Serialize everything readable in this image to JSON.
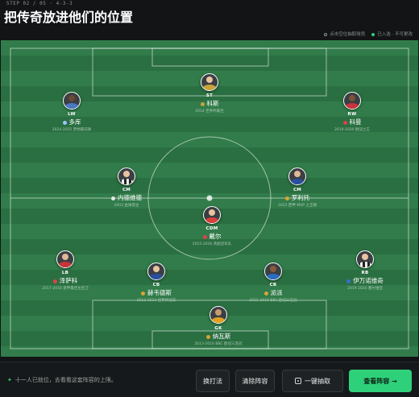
{
  "header": {
    "step": "STEP 02 / 05 · 4-3-3",
    "title": "把传奇放进他们的位置",
    "legend_pick": "点击空位抽取球员",
    "legend_done": "已入选 · 不可更改"
  },
  "colors": {
    "accent": "#2fd07a",
    "pitch_light": "#317c4a",
    "pitch_dark": "#2a6f41"
  },
  "players": [
    {
      "id": "st",
      "position": "ST",
      "name": "科斯",
      "season": "2014 世界杯最佳",
      "kit": "#c9a33a",
      "skin": "#e9c3a1"
    },
    {
      "id": "lw",
      "position": "LW",
      "name": "多库",
      "season": "2024-2025 梦想最前锋",
      "kit": "#4a78c2",
      "skin": "#6b4a35"
    },
    {
      "id": "rw",
      "position": "RW",
      "name": "科曼",
      "season": "2019-2020 欧冠之王",
      "kit": "#c8343a",
      "skin": "#7a5238"
    },
    {
      "id": "cm_l",
      "position": "CM",
      "name": "内德维德",
      "season": "2003 金球得主",
      "kit": "#222222",
      "skin": "#e9c3a1"
    },
    {
      "id": "cm_r",
      "position": "CM",
      "name": "罗利托",
      "season": "2023 西甲 MVP 之王朝",
      "kit": "#2a4fa0",
      "skin": "#e0b896"
    },
    {
      "id": "cdm",
      "position": "CDM",
      "name": "戴尔",
      "season": "2015-2016 英超冠军队",
      "kit": "#d8403a",
      "skin": "#e9c3a1"
    },
    {
      "id": "lb",
      "position": "LB",
      "name": "泽萨科",
      "season": "2017-2018 意甲最佳左后卫",
      "kit": "#c8343a",
      "skin": "#e0b896"
    },
    {
      "id": "cb_l",
      "position": "CB",
      "name": "赫韦德斯",
      "season": "2013-2014 世界杯冠军",
      "kit": "#2a4fa0",
      "skin": "#e9c3a1"
    },
    {
      "id": "cb_r",
      "position": "CB",
      "name": "派派",
      "season": "2015-2016 BBC 欧冠三连冠",
      "kit": "#2a6cc2",
      "skin": "#8a5a3c"
    },
    {
      "id": "rb",
      "position": "RB",
      "name": "伊万诺维奇",
      "season": "2019 2020 塞尔维亚",
      "kit": "#555555",
      "skin": "#e9c3a1"
    },
    {
      "id": "gk",
      "position": "GK",
      "name": "纳瓦斯",
      "season": "2013-2016 BBC 欧冠三连冠",
      "kit": "#e0a020",
      "skin": "#c99a70"
    }
  ],
  "footer": {
    "hint": "十一人已就位，去看看这套阵容的上限。",
    "tactic_label": "换打法",
    "clear_label": "清除阵容",
    "draw_label": "一键抽取",
    "view_label": "查看阵容 →"
  }
}
